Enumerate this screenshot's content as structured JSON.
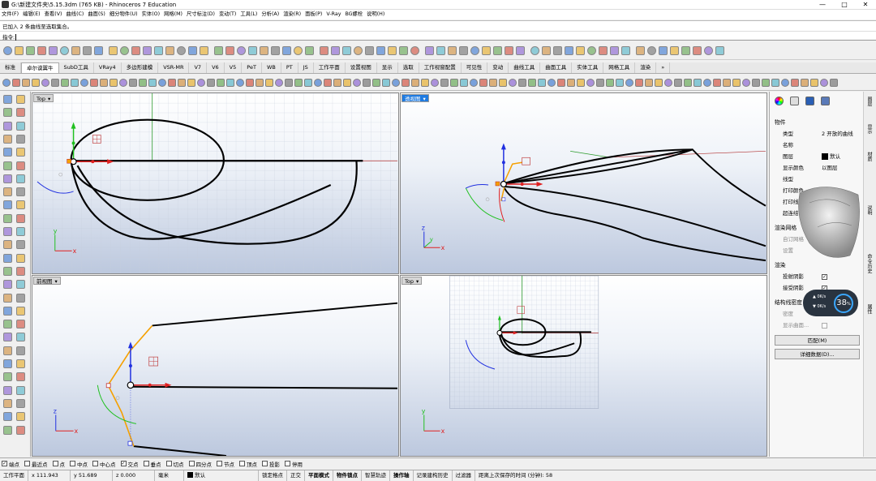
{
  "titlebar": {
    "title": "G:\\新建文件夹\\5.15.3dm (765 KB) - Rhinoceros 7 Education",
    "minimize": "—",
    "maximize": "□",
    "close": "✕"
  },
  "menu": [
    "文件(F)",
    "编辑(E)",
    "查看(V)",
    "曲线(C)",
    "曲面(S)",
    "细分物件(U)",
    "实体(O)",
    "网格(M)",
    "尺寸标注(D)",
    "变动(T)",
    "工具(L)",
    "分析(A)",
    "渲染(R)",
    "面板(P)",
    "V-Ray",
    "BG螺栓",
    "说明(H)"
  ],
  "command": {
    "history": "已加入 2 条曲线至选取集合。",
    "prompt": "指令:"
  },
  "tabs": [
    "标准",
    "卓尔谟翼牛",
    "SubD工具",
    "VRay4",
    "多边形建模",
    "VSR-MR",
    "V7",
    "V6",
    "V5",
    "PeT",
    "WB",
    "PT",
    "JS",
    "工作平面",
    "设置视图",
    "显示",
    "选取",
    "工作视窗配置",
    "可见性",
    "变动",
    "曲线工具",
    "曲面工具",
    "实体工具",
    "网格工具",
    "渲染"
  ],
  "tabs_more": "»",
  "viewports": {
    "top_left": {
      "label": "Top"
    },
    "top_right": {
      "label": "透视图"
    },
    "bottom_left": {
      "label": "前视图"
    },
    "bottom_right": {
      "label": "Top"
    }
  },
  "axes": {
    "x": "x",
    "y": "y",
    "z": "z"
  },
  "props": {
    "section_object": "物件",
    "rows": [
      {
        "k": "类型",
        "v": "2 开放的曲线"
      },
      {
        "k": "名称",
        "v": ""
      },
      {
        "k": "图层",
        "v": "默认"
      },
      {
        "k": "显示颜色",
        "v": "以图层"
      },
      {
        "k": "线型",
        "v": ""
      },
      {
        "k": "打印颜色",
        "v": ""
      },
      {
        "k": "打印线宽",
        "v": ""
      },
      {
        "k": "超连结",
        "v": ""
      }
    ],
    "section_render": "渲染网格",
    "render_rows": [
      "自订网格",
      "设置"
    ],
    "section_shadow": "渲染",
    "shadow_rows": [
      "投射阴影",
      "接受阴影"
    ],
    "section_iso": "结构线密度",
    "iso_rows": [
      "密度",
      "显示曲面..."
    ],
    "btn_match": "匹配(M)",
    "btn_details": "详细数据(D)..."
  },
  "right_tabs": [
    "图层",
    "显示",
    "材质",
    "说明",
    "命令历史",
    "属性"
  ],
  "widget": {
    "up": "0K/s",
    "down": "0K/s",
    "percent": "38",
    "unit": "%"
  },
  "osnap": [
    {
      "label": "端点",
      "checked": true
    },
    {
      "label": "最近点",
      "checked": false
    },
    {
      "label": "点",
      "checked": false
    },
    {
      "label": "中点",
      "checked": false
    },
    {
      "label": "中心点",
      "checked": false
    },
    {
      "label": "交点",
      "checked": true
    },
    {
      "label": "垂点",
      "checked": false
    },
    {
      "label": "切点",
      "checked": false
    },
    {
      "label": "四分点",
      "checked": false
    },
    {
      "label": "节点",
      "checked": false
    },
    {
      "label": "顶点",
      "checked": false
    },
    {
      "label": "投影",
      "checked": false
    },
    {
      "label": "停用",
      "checked": false
    }
  ],
  "status": {
    "plane": "工作平面",
    "x": "x 111.943",
    "y": "y 51.689",
    "z": "z 0.000",
    "unit": "毫米",
    "layer": "默认",
    "items": [
      "锁定格点",
      "正交",
      "平面模式",
      "物件锁点",
      "智慧轨迹",
      "操作轴",
      "记录建构历史",
      "过滤器"
    ],
    "bold": [
      "平面模式",
      "物件锁点",
      "操作轴"
    ],
    "autosave": "距离上次保存的时间 (分钟): 58"
  },
  "colors": {
    "accent": "#1e7ae0",
    "curve": "#000000",
    "xaxis": "#e02020",
    "yaxis": "#20c020",
    "zaxis": "#2030e0",
    "orange": "#f5a000"
  }
}
